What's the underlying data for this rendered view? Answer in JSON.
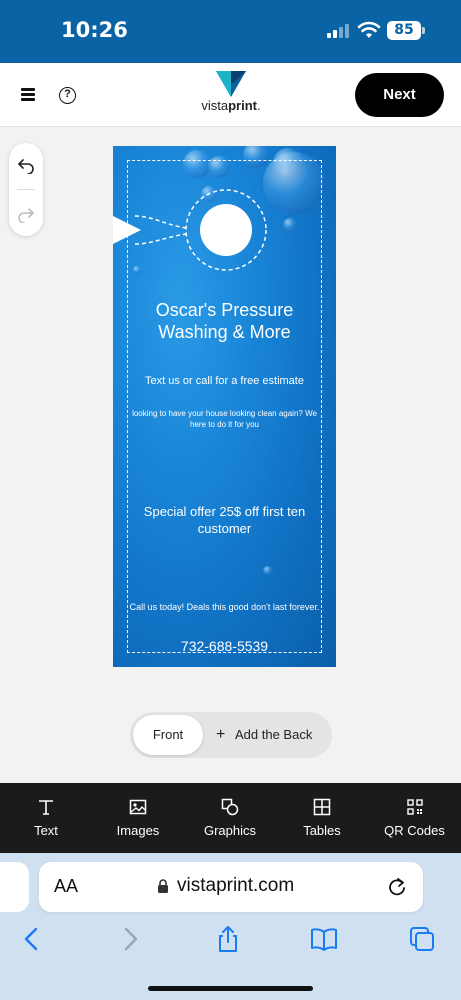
{
  "status_bar": {
    "time": "10:26",
    "battery": "85"
  },
  "header": {
    "logo_text_a": "vista",
    "logo_text_b": "print",
    "logo_text_c": ".",
    "next_label": "Next"
  },
  "design": {
    "title": "Oscar's Pressure Washing & More",
    "subtitle": "Text us or call for a free estimate",
    "small_text": "looking to have your house looking clean again? We here to do it for you",
    "offer": "Special offer 25$ off first ten customer",
    "call_text": "Call us today! Deals this good don't last forever.",
    "phone": "732-688-5539"
  },
  "sides": {
    "front_label": "Front",
    "add_back_label": "Add the Back"
  },
  "toolbar": [
    {
      "label": "Text",
      "icon": "text-icon"
    },
    {
      "label": "Images",
      "icon": "image-icon"
    },
    {
      "label": "Graphics",
      "icon": "shapes-icon"
    },
    {
      "label": "Tables",
      "icon": "table-icon"
    },
    {
      "label": "QR Codes",
      "icon": "qr-code-icon"
    }
  ],
  "browser": {
    "aa": "AA",
    "url": "vistaprint.com"
  },
  "colors": {
    "brand_blue": "#0a63a4",
    "toolbar_bg": "#1b1b1b",
    "accent_black": "#000000"
  }
}
